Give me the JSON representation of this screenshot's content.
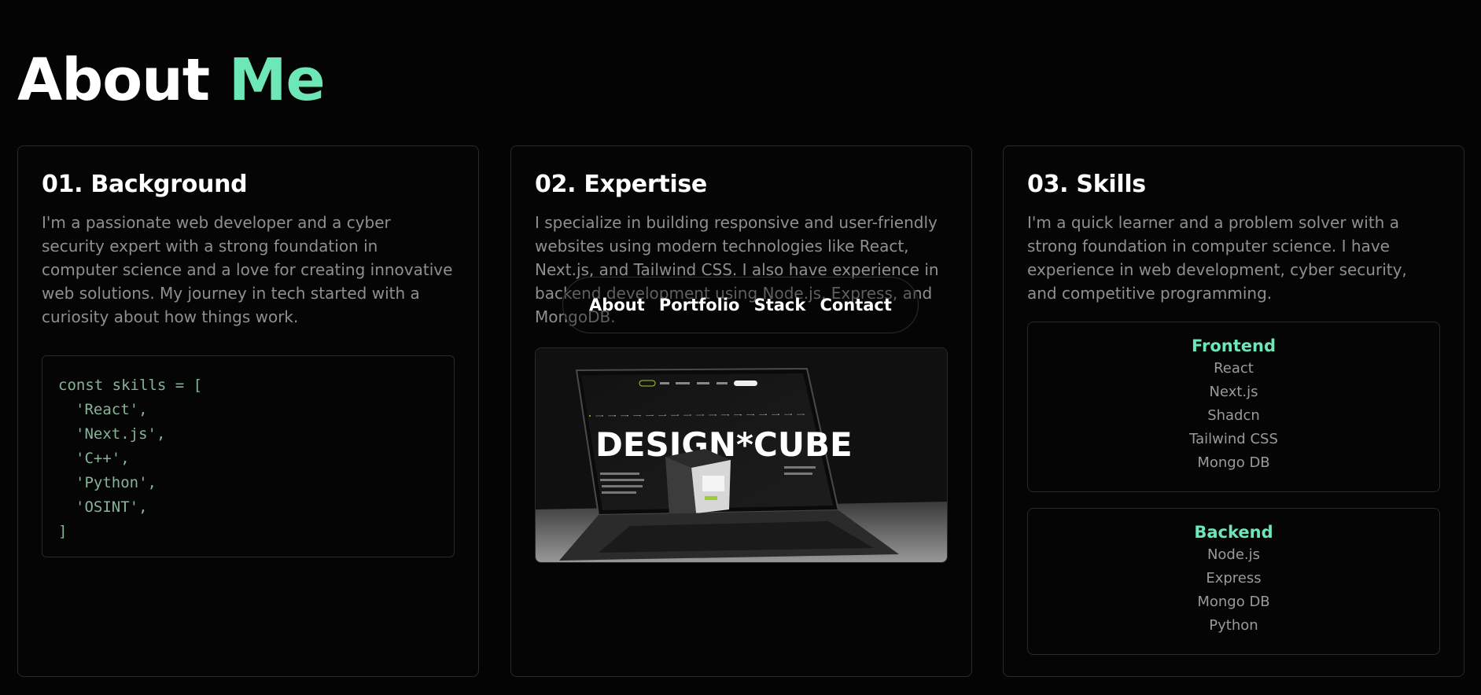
{
  "header": {
    "title_main": "About",
    "title_accent": "Me",
    "accent_color": "#6ee7b7"
  },
  "nav": {
    "items": [
      "About",
      "Portfolio",
      "Stack",
      "Contact"
    ]
  },
  "background": {
    "heading": "01. Background",
    "text": "I'm a passionate web developer and a cyber security expert with a strong foundation in computer science and a love for creating innovative web solutions. My journey in tech started with a curiosity about how things work.",
    "code": {
      "open": "const skills = [",
      "items": [
        "'React',",
        "'Next.js',",
        "'C++',",
        "'Python',",
        "'OSINT',"
      ],
      "close": "]"
    }
  },
  "expertise": {
    "heading": "02. Expertise",
    "text": "I specialize in building responsive and user-friendly websites using modern technologies like React, Next.js, and Tailwind CSS. I also have experience in backend development using Node.js, Express, and MongoDB.",
    "image": {
      "brand": "DESIGN*CUBE",
      "nav": [
        "Home",
        "About",
        "Services",
        "Projects",
        "Contact",
        "Call Us Now"
      ]
    }
  },
  "skills": {
    "heading": "03. Skills",
    "text": "I'm a quick learner and a problem solver with a strong foundation in computer science. I have experience in web development, cyber security, and competitive programming.",
    "frontend": {
      "title": "Frontend",
      "items": [
        "React",
        "Next.js",
        "Shadcn",
        "Tailwind CSS",
        "Mongo DB"
      ]
    },
    "backend": {
      "title": "Backend",
      "items": [
        "Node.js",
        "Express",
        "Mongo DB",
        "Python"
      ]
    }
  }
}
